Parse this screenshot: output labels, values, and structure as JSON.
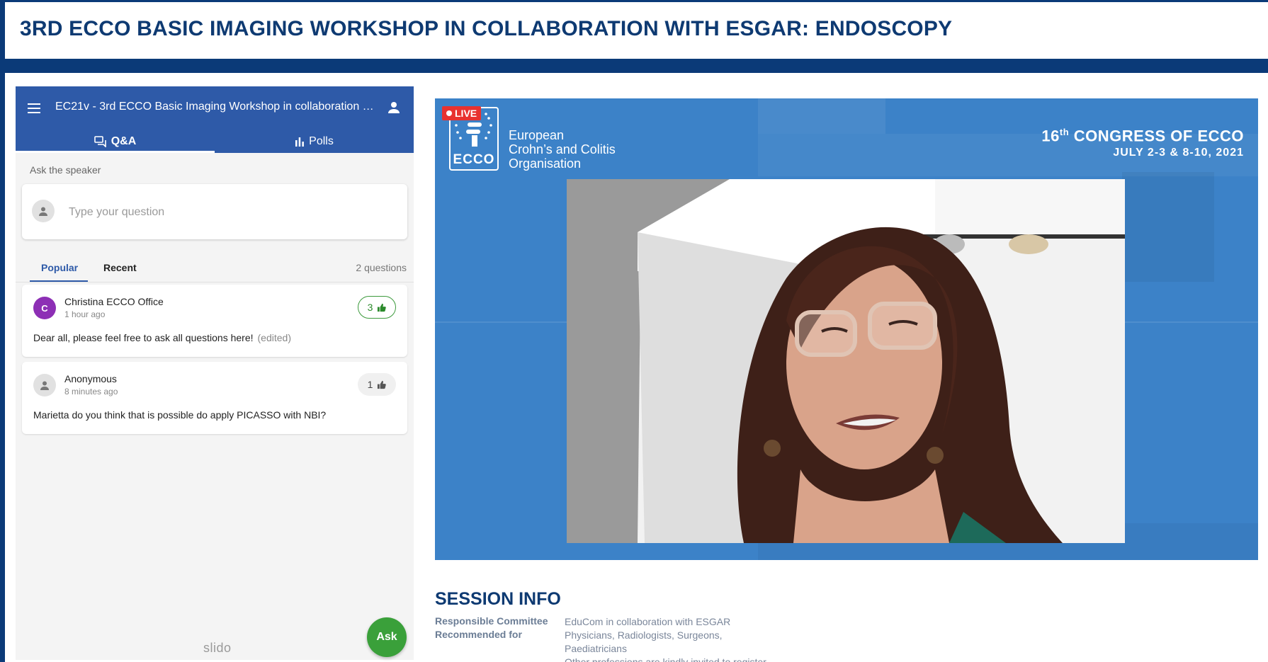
{
  "page": {
    "title": "3RD ECCO BASIC IMAGING WORKSHOP IN COLLABORATION WITH ESGAR: ENDOSCOPY"
  },
  "slido": {
    "event_title": "EC21v - 3rd ECCO Basic Imaging Workshop in collaboration w...",
    "tabs": [
      {
        "label": "Q&A",
        "icon": "chat-bubbles-icon"
      },
      {
        "label": "Polls",
        "icon": "bar-chart-icon"
      }
    ],
    "ask_label": "Ask the speaker",
    "question_placeholder": "Type your question",
    "sort": {
      "popular": "Popular",
      "recent": "Recent"
    },
    "question_count": "2 questions",
    "questions": [
      {
        "initial": "C",
        "author": "Christina ECCO Office",
        "time": "1 hour ago",
        "text": "Dear all, please feel free to ask all questions here!",
        "edited": "(edited)",
        "likes": "3"
      },
      {
        "author": "Anonymous",
        "time": "8 minutes ago",
        "text": "Marietta do you think that is possible do apply PICASSO with NBI?",
        "likes": "1"
      }
    ],
    "brand": "slido",
    "ask_button": "Ask",
    "colors": {
      "header": "#2e5aa8",
      "accent_green": "#3aa03a",
      "avatar_purple": "#8d2fb5"
    }
  },
  "video": {
    "live_label": "LIVE",
    "logo_text": "ECCO",
    "org_name": [
      "European",
      "Crohn’s and Colitis",
      "Organisation"
    ],
    "congress_number": "16",
    "congress_suffix": "th",
    "congress_rest": " CONGRESS OF ECCO",
    "congress_dates": "JULY 2-3 & 8-10, 2021"
  },
  "session_info": {
    "title": "SESSION INFO",
    "rows": [
      {
        "label": "Responsible Committee",
        "value": "EduCom in collaboration with ESGAR"
      },
      {
        "label": "Recommended for",
        "value_lines": [
          "Physicians, Radiologists, Surgeons,",
          "Paediatricians",
          "Other professions are kindly invited to register"
        ]
      }
    ]
  }
}
